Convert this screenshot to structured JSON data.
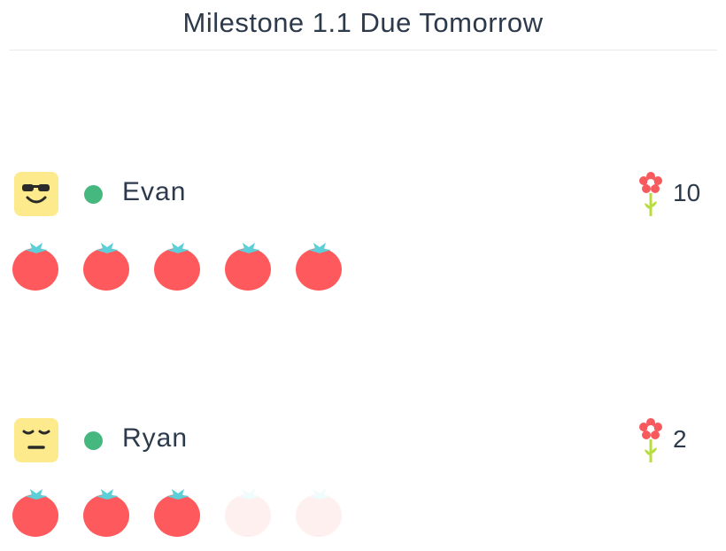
{
  "header": {
    "title": "Milestone 1.1 Due Tomorrow"
  },
  "colors": {
    "tomato_active": "#fe5a5d",
    "tomato_inactive": "#fff0f0",
    "stem_active": "#5ccfd8",
    "stem_inactive": "#f0fbfc",
    "avatar_bg": "#fdea8c",
    "online": "#45b87f",
    "text": "#2c3a4b",
    "flower_petal": "#f75a5d",
    "flower_stem": "#b8dd3e"
  },
  "members": [
    {
      "name": "Evan",
      "avatar_icon": "cool-sunglasses-face-icon",
      "status": "online",
      "flower_icon": "flower-icon",
      "score": "10",
      "tomatoes_total": 5,
      "tomatoes_done": 5
    },
    {
      "name": "Ryan",
      "avatar_icon": "unamused-face-icon",
      "status": "online",
      "flower_icon": "flower-icon",
      "score": "2",
      "tomatoes_total": 5,
      "tomatoes_done": 3
    }
  ]
}
